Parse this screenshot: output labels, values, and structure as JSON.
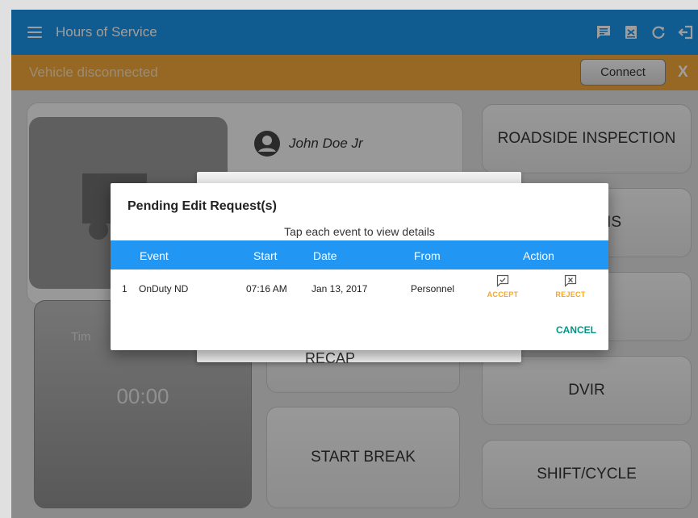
{
  "app": {
    "title": "Hours of Service"
  },
  "toolbar": {
    "icons": [
      "message-icon",
      "certify-icon",
      "refresh-icon",
      "logout-icon"
    ]
  },
  "status": {
    "text": "Vehicle disconnected",
    "connect_label": "Connect",
    "close_label": "X"
  },
  "dashboard": {
    "driver_name": "John Doe Jr",
    "timer_label": "Tim",
    "timer_value": "00:00",
    "recap_label": "RECAP",
    "start_break_label": "START BREAK",
    "roadside_label": "ROADSIDE INSPECTION",
    "second_tile_partial": "IS",
    "dvir_label": "DVIR",
    "shift_cycle_label": "SHIFT/CYCLE"
  },
  "dialog": {
    "title": "Pending Edit Request(s)",
    "subtitle": "Tap each event to view details",
    "columns": [
      "Event",
      "Start",
      "Date",
      "From",
      "Action"
    ],
    "rows": [
      {
        "num": "1",
        "event": "OnDuty ND",
        "start": "07:16 AM",
        "date": "Jan 13, 2017",
        "from": "Personnel",
        "accept_label": "ACCEPT",
        "reject_label": "REJECT"
      }
    ],
    "cancel_label": "CANCEL"
  },
  "colors": {
    "appbar": "#1a93e8",
    "status": "#f2a83b",
    "table_header": "#2196f3",
    "accent": "#f5a623",
    "cancel": "#009688"
  }
}
